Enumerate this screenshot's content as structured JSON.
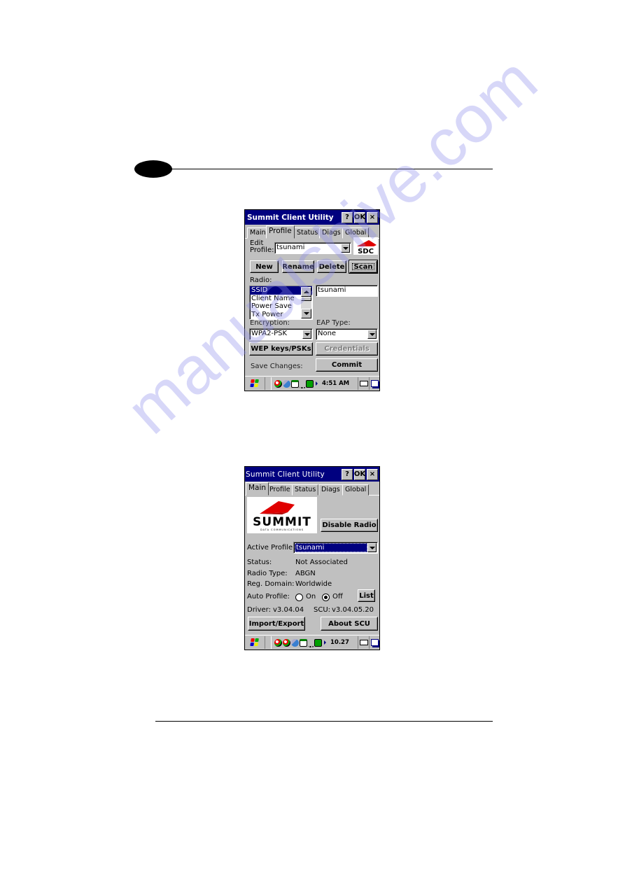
{
  "page": {
    "watermark": "manualshive.com"
  },
  "screen1": {
    "title": "Summit Client Utility",
    "title_buttons": [
      "?",
      "OK",
      "×"
    ],
    "tabs": [
      "Main",
      "Profile",
      "Status",
      "Diags",
      "Global"
    ],
    "active_tab": "Profile",
    "edit_profile_label_line1": "Edit",
    "edit_profile_label_line2": "Profile:",
    "edit_profile_value": "tsunami",
    "logo_text": "SDC",
    "buttons": {
      "new": "New",
      "rename": "Rename",
      "delete": "Delete",
      "scan": "Scan"
    },
    "radio_label": "Radio:",
    "radio_list": [
      "SSID",
      "Client Name",
      "Power Save",
      "Tx Power"
    ],
    "radio_selected": "SSID",
    "ssid_value": "tsunami",
    "encryption_label": "Encryption:",
    "encryption_value": "WPA2-PSK",
    "eap_label": "EAP Type:",
    "eap_value": "None",
    "wep_button": "WEP keys/PSKs",
    "credentials_button": "Credentials",
    "save_label": "Save Changes:",
    "commit_button": "Commit",
    "clock": "4:51 AM"
  },
  "screen2": {
    "title": "Summit Client Utility",
    "title_buttons": [
      "?",
      "OK",
      "×"
    ],
    "tabs": [
      "Main",
      "Profile",
      "Status",
      "Diags",
      "Global"
    ],
    "active_tab": "Main",
    "logo_text": "SUMMIT",
    "logo_subtext": "DATA COMMUNICATIONS",
    "disable_radio_button": "Disable Radio",
    "active_profile_label": "Active Profile:",
    "active_profile_value": "tsunami",
    "status_label": "Status:",
    "status_value": "Not Associated",
    "radio_type_label": "Radio Type:",
    "radio_type_value": "ABGN",
    "reg_domain_label": "Reg. Domain:",
    "reg_domain_value": "Worldwide",
    "auto_profile_label": "Auto Profile:",
    "auto_profile_on": "On",
    "auto_profile_off": "Off",
    "auto_profile_selected": "Off",
    "list_button": "List",
    "driver_label": "Driver:",
    "driver_value": "v3.04.04",
    "scu_label": "SCU:",
    "scu_value": "v3.04.05.20",
    "import_export_button": "Import/Export",
    "about_button": "About SCU",
    "clock": "10.27"
  }
}
